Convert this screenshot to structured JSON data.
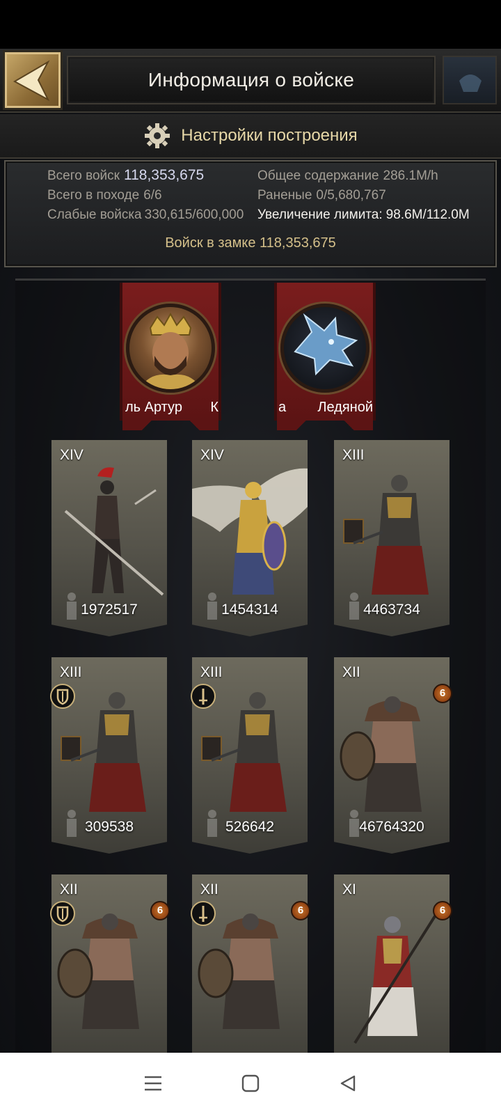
{
  "header": {
    "title": "Информация о войске"
  },
  "settings": {
    "label": "Настройки построения"
  },
  "stats": {
    "total_troops_label": "Всего войск",
    "total_troops_value": "118,353,675",
    "upkeep_label": "Общее содержание",
    "upkeep_value": "286.1M/h",
    "marching_label": "Всего в походе",
    "marching_value": "6/6",
    "wounded_label": "Раненые",
    "wounded_value": "0/5,680,767",
    "weak_label": "Слабые войска",
    "weak_value": "330,615/600,000",
    "limit_label": "Увеличение лимита:",
    "limit_value": "98.6M/112.0M",
    "castle_line": "Войск в замке 118,353,675"
  },
  "heroes": [
    {
      "name_left": "ль Артур",
      "name_right": "К"
    },
    {
      "name_left": "а",
      "name_right": "Ледяной"
    }
  ],
  "troops": [
    {
      "tier": "XIV",
      "count": "1972517"
    },
    {
      "tier": "XIV",
      "count": "1454314"
    },
    {
      "tier": "XIII",
      "count": "4463734"
    },
    {
      "tier": "XIII",
      "count": "309538",
      "badge": "shield-icon"
    },
    {
      "tier": "XIII",
      "count": "526642",
      "badge": "sword-icon"
    },
    {
      "tier": "XII",
      "count": "46764320",
      "level": "6"
    },
    {
      "tier": "XII",
      "count": "",
      "badge": "shield-icon",
      "level": "6"
    },
    {
      "tier": "XII",
      "count": "",
      "badge": "sword-icon",
      "level": "6"
    },
    {
      "tier": "XI",
      "count": "",
      "level": "6"
    }
  ]
}
